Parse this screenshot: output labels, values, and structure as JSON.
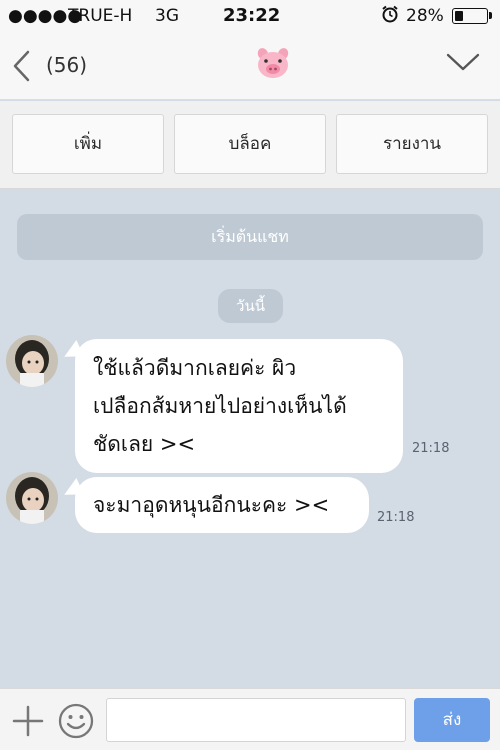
{
  "status_bar": {
    "signal": "●●●●●",
    "carrier": "TRUE-H",
    "network": "3G",
    "time": "23:22",
    "battery_percent": "28%",
    "battery_level": 0.28
  },
  "nav": {
    "unread_count": "(56)",
    "chat_icon": "pig-face-icon"
  },
  "actions": {
    "add": "เพิ่ม",
    "block": "บล็อค",
    "report": "รายงาน"
  },
  "chat": {
    "start_label": "เริ่มต้นแชท",
    "date_label": "วันนี้",
    "messages": [
      {
        "lines": [
          "ใช้แล้วดีมากเลยค่ะ  ผิว",
          "เปลือกส้มหายไปอย่างเห็นได้",
          "ชัดเลย  ><"
        ],
        "time": "21:18"
      },
      {
        "lines": [
          "จะมาอุดหนุนอีกนะคะ  ><"
        ],
        "time": "21:18"
      }
    ]
  },
  "composer": {
    "input_value": "",
    "send_label": "ส่ง"
  },
  "colors": {
    "chat_background": "#d3dbe4",
    "send_button": "#6da0e8",
    "pill": "#bfc9d3"
  }
}
